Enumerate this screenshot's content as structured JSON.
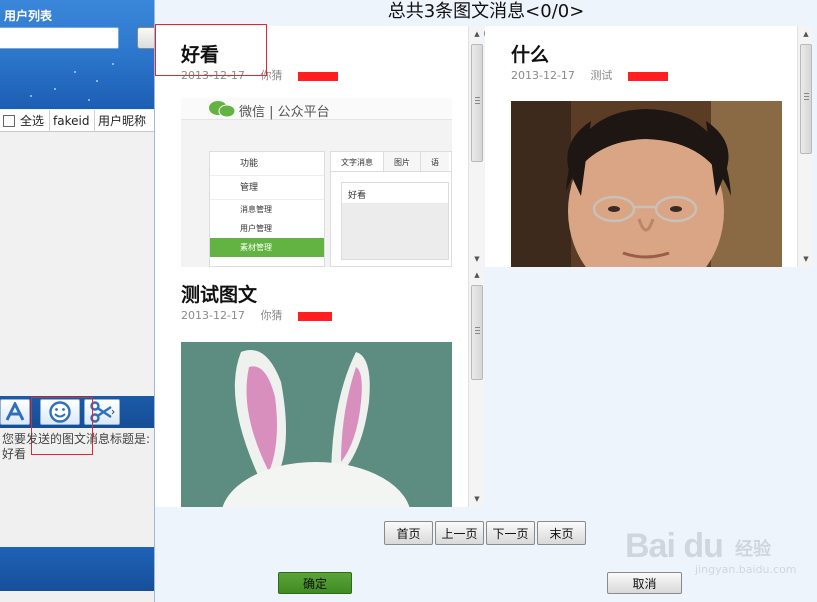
{
  "left_panel": {
    "title": "用户列表",
    "columns": {
      "select_all": "全选",
      "fakeid": "fakeid",
      "nickname": "用户昵称"
    },
    "hint_label": "您要发送的图文消息标题是:",
    "hint_value": "好看"
  },
  "dialog": {
    "title": "总共3条图文消息<0/0>",
    "cards": [
      {
        "title": "好看",
        "date": "2013-12-17",
        "author": "你猜"
      },
      {
        "title": "什么",
        "date": "2013-12-17",
        "author": "测试"
      },
      {
        "title": "测试图文",
        "date": "2013-12-17",
        "author": "你猜"
      }
    ],
    "wechat_preview": {
      "brand": "微信 | 公众平台",
      "sidebar": [
        "功能",
        "管理",
        "消息管理",
        "用户管理",
        "素材管理"
      ],
      "tabs": [
        "文字消息",
        "图片",
        "语"
      ],
      "content_title": "好看"
    },
    "pager": {
      "first": "首页",
      "prev": "上一页",
      "next": "下一页",
      "last": "末页"
    },
    "ok_label": "确定",
    "cancel_label": "取消"
  },
  "watermark": {
    "logo": "Bai du",
    "cn": "经验",
    "url": "jingyan.baidu.com"
  },
  "colors": {
    "accent_blue": "#1c5eb4",
    "ok_green": "#4a9a2d",
    "redaction": "#ff1f1f",
    "wechat_green": "#63b342"
  }
}
